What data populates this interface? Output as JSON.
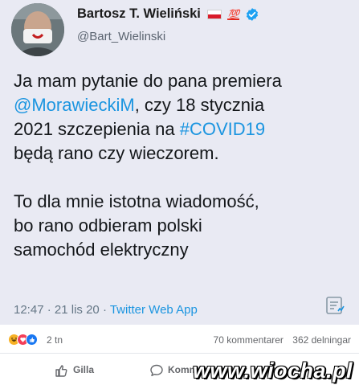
{
  "tweet": {
    "author_name": "Bartosz T. Wieliński",
    "emoji_hundred": "💯",
    "handle": "@Bart_Wielinski",
    "text": {
      "l1": "Ja mam pytanie do pana premiera",
      "l2_mention": "@MorawieckiM",
      "l2_rest": ", czy 18 stycznia",
      "l3_start": "2021 szczepienia na ",
      "l3_hashtag": "#COVID19",
      "l4": "będą rano czy wieczorem.",
      "l5": "To dla mnie istotna wiadomość,",
      "l6": "bo rano odbieram polski",
      "l7": "samochód elektryczny"
    },
    "time": "12:47",
    "date": "21 lis 20",
    "separator": "·",
    "app": "Twitter Web App",
    "icons": [
      "avatar",
      "poland-flag-icon",
      "verified-badge-icon",
      "analytics-icon"
    ]
  },
  "facebook": {
    "reaction_icons": [
      "haha-icon",
      "love-icon",
      "like-icon"
    ],
    "reaction_count": "2 tn",
    "comments": "70 kommentarer",
    "shares": "362 delningar",
    "like_label": "Gilla",
    "comment_label": "Kommentera"
  },
  "watermark": "www.wiocha.pl",
  "colors": {
    "tweet_bg": "#e9eaf3",
    "link": "#1b95e0",
    "verified": "#1da1f2",
    "flag_red": "#d91c2a"
  }
}
